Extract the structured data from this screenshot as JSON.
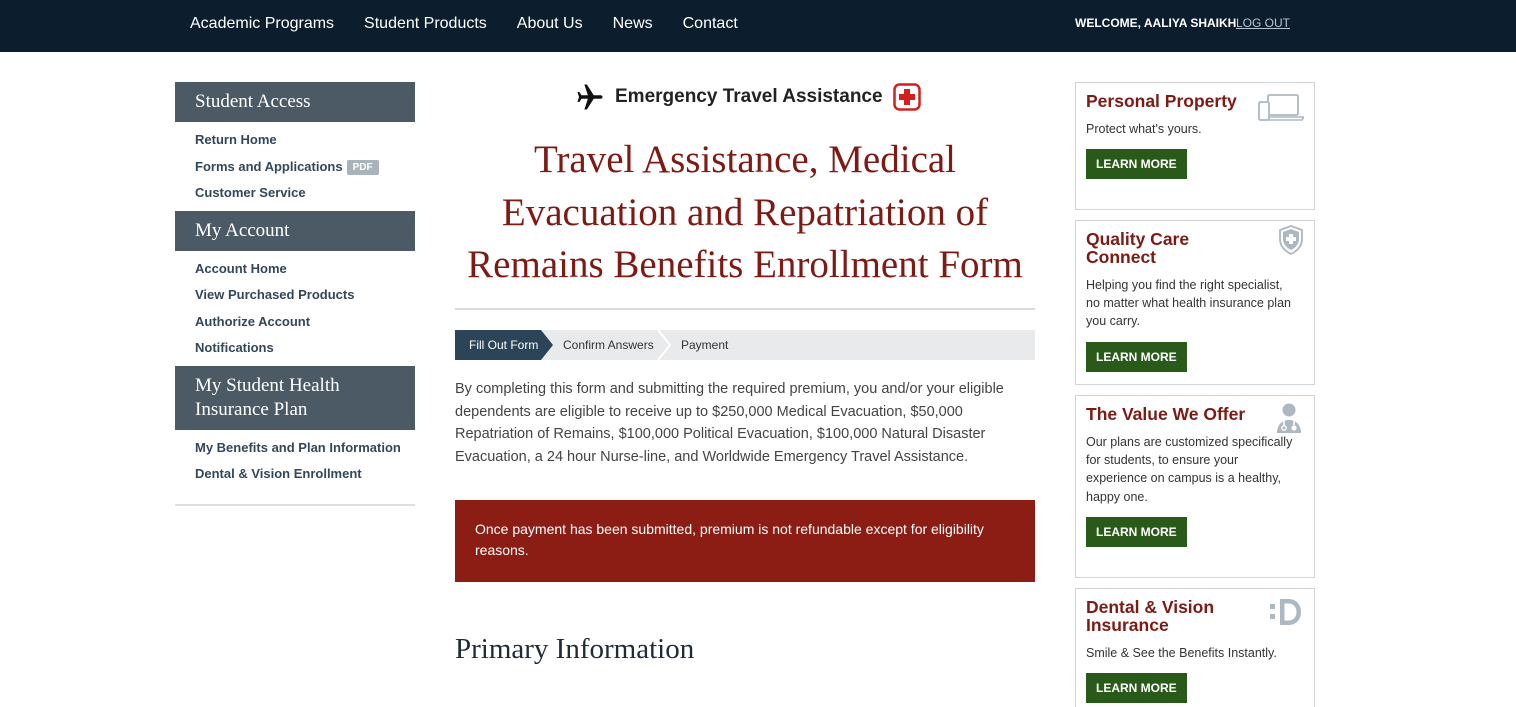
{
  "topnav": {
    "links": [
      "Academic Programs",
      "Student Products",
      "About Us",
      "News",
      "Contact"
    ],
    "welcome": "WELCOME, AALIYA SHAIKH",
    "logout": "LOG OUT"
  },
  "sidebar": {
    "sections": [
      {
        "title": "Student Access",
        "items": [
          "Return Home",
          "Forms and Applications",
          "Customer Service"
        ]
      },
      {
        "title": "My Account",
        "items": [
          "Account Home",
          "View Purchased Products",
          "Authorize Account",
          "Notifications"
        ]
      },
      {
        "title_line1": "My Student Health",
        "title_line2": "Insurance Plan",
        "items": [
          "My Benefits and Plan Information",
          "Dental & Vision Enrollment"
        ]
      }
    ],
    "pdf_badge": "PDF"
  },
  "main": {
    "eta_title": "Emergency Travel Assistance",
    "title_lines": [
      "Travel Assistance, Medical",
      "Evacuation and Repatriation of",
      "Remains Benefits Enrollment Form"
    ],
    "steps": [
      "Fill Out Form",
      "Confirm Answers",
      "Payment"
    ],
    "intro_lines": [
      "By completing this form and submitting the required premium, you and/or your eligible",
      "dependents are eligible to receive up to $250,000 Medical Evacuation, $50,000",
      "Repatriation of Remains, $100,000 Political Evacuation, $100,000 Natural Disaster",
      "Evacuation, a 24 hour Nurse-line, and Worldwide Emergency Travel Assistance."
    ],
    "alert_lines": [
      "Once payment has been submitted, premium is not refundable except for eligibility",
      "reasons."
    ],
    "section_title": "Primary Information"
  },
  "promos": [
    {
      "title": "Personal Property",
      "text_lines": [
        "Protect what's yours."
      ],
      "button": "LEARN MORE",
      "icon": "devices-icon"
    },
    {
      "title": "Quality Care Connect",
      "text_lines": [
        "Helping you find the right specialist,",
        "no matter what health insurance plan",
        "you carry."
      ],
      "button": "LEARN MORE",
      "icon": "shield-cross-icon"
    },
    {
      "title": "The Value We Offer",
      "text_lines": [
        "Our plans are customized specifically",
        "for students, to ensure your",
        "experience on campus is a healthy,",
        "happy one."
      ],
      "button": "LEARN MORE",
      "icon": "doctor-icon"
    },
    {
      "title_line1": "Dental & Vision",
      "title_line2": "Insurance",
      "text_lines": [
        "Smile & See the Benefits Instantly."
      ],
      "button": "LEARN MORE",
      "icon": "smile-icon"
    }
  ],
  "colors": {
    "nav_bg": "#0c1e2e",
    "sidebar_head": "#4b5a64",
    "brand_red": "#7e1a14",
    "alert_bg": "#8b1d14",
    "button_green": "#2a5a19",
    "step_active": "#2c4458"
  }
}
